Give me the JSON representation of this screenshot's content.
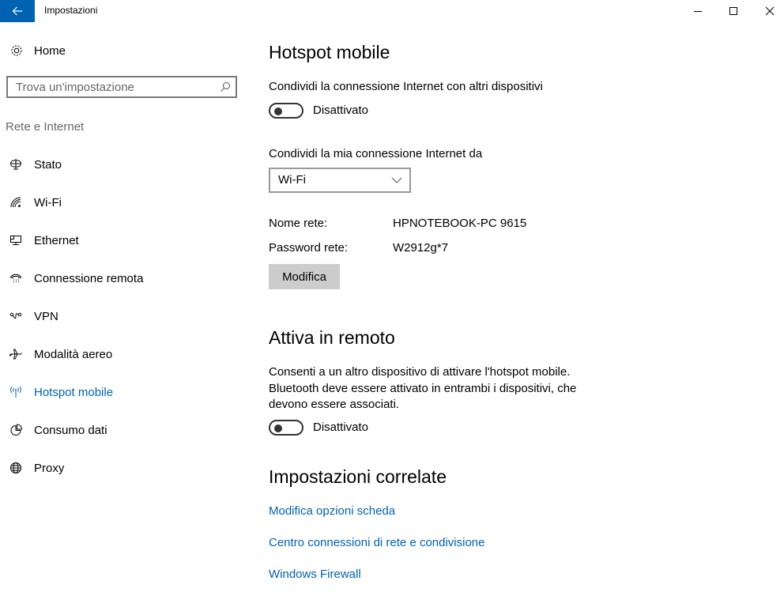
{
  "window": {
    "title": "Impostazioni",
    "controls": {
      "minimize": "minimize",
      "maximize": "maximize",
      "close": "close"
    }
  },
  "sidebar": {
    "home_label": "Home",
    "search_placeholder": "Trova un'impostazione",
    "section_label": "Rete e Internet",
    "items": [
      {
        "label": "Stato",
        "icon": "status-globe-icon",
        "active": false
      },
      {
        "label": "Wi-Fi",
        "icon": "wifi-icon",
        "active": false
      },
      {
        "label": "Ethernet",
        "icon": "ethernet-icon",
        "active": false
      },
      {
        "label": "Connessione remota",
        "icon": "dialup-phone-icon",
        "active": false
      },
      {
        "label": "VPN",
        "icon": "vpn-icon",
        "active": false
      },
      {
        "label": "Modalità aereo",
        "icon": "airplane-icon",
        "active": false
      },
      {
        "label": "Hotspot mobile",
        "icon": "hotspot-icon",
        "active": true
      },
      {
        "label": "Consumo dati",
        "icon": "data-usage-icon",
        "active": false
      },
      {
        "label": "Proxy",
        "icon": "proxy-globe-icon",
        "active": false
      }
    ]
  },
  "main": {
    "title": "Hotspot mobile",
    "share_label": "Condividi la connessione Internet con altri dispositivi",
    "share_toggle": {
      "state": "Disattivato",
      "on": false
    },
    "share_from_label": "Condividi la mia connessione Internet da",
    "share_from_value": "Wi-Fi",
    "network_name_label": "Nome rete:",
    "network_name_value": "HPNOTEBOOK-PC 9615",
    "password_label": "Password rete:",
    "password_value": "W2912g*7",
    "edit_button": "Modifica",
    "remote": {
      "title": "Attiva in remoto",
      "description": "Consenti a un altro dispositivo di attivare l'hotspot mobile. Bluetooth deve essere attivato in entrambi i dispositivi, che devono essere associati.",
      "toggle": {
        "state": "Disattivato",
        "on": false
      }
    },
    "related": {
      "title": "Impostazioni correlate",
      "links": [
        "Modifica opzioni scheda",
        "Centro connessioni di rete e condivisione",
        "Windows Firewall"
      ]
    }
  },
  "colors": {
    "accent": "#0063b1",
    "button_gray": "#cccccc"
  }
}
